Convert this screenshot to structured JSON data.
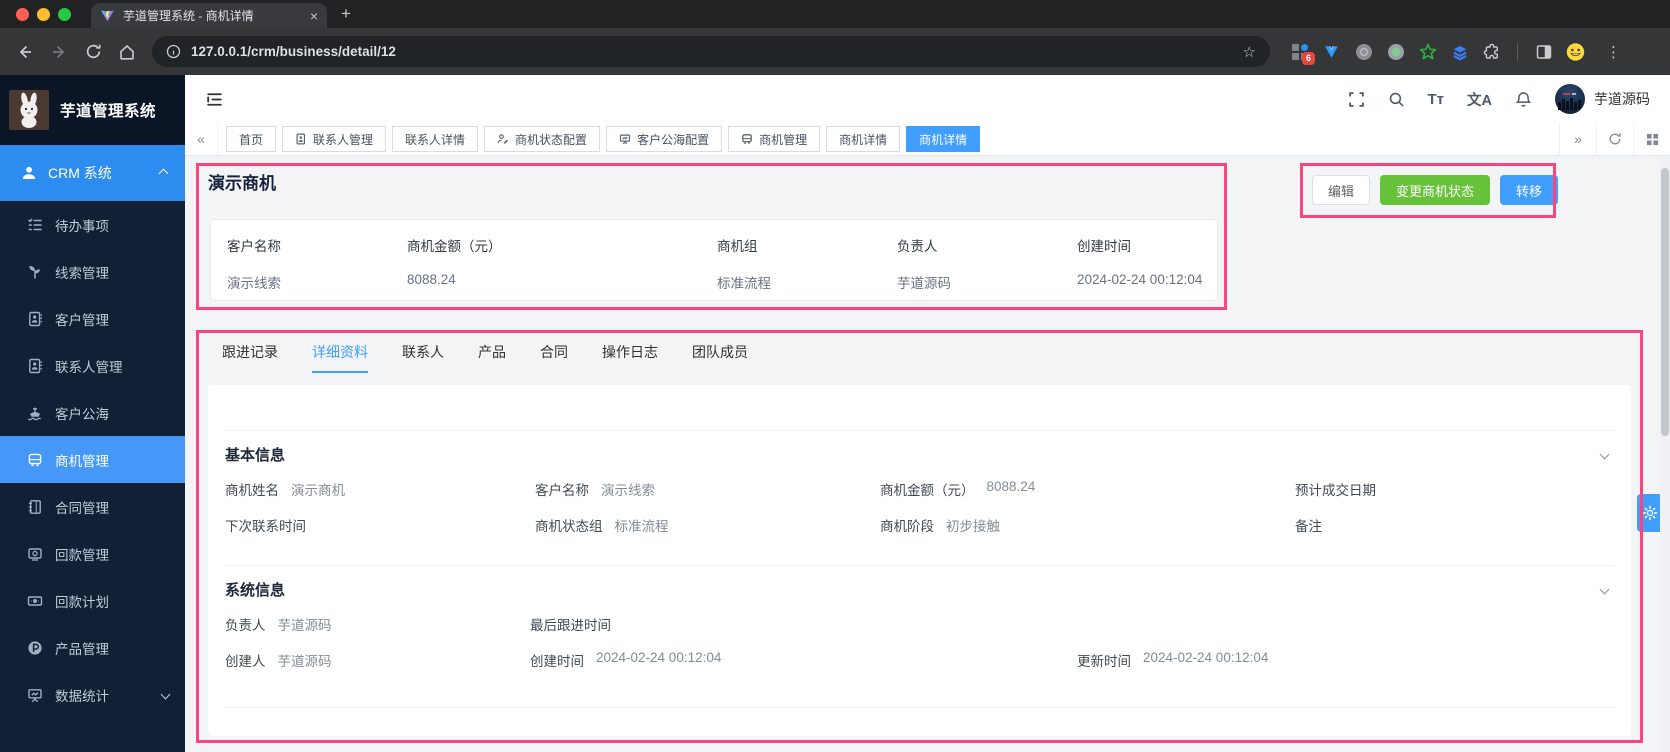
{
  "browser": {
    "tab_title": "芋道管理系统 - 商机详情",
    "url": "127.0.0.1/crm/business/detail/12",
    "extension_badge": "6"
  },
  "icons": {
    "close": "×",
    "new_tab": "+",
    "star": "☆",
    "kebab": "⋮",
    "collapse_left": "«",
    "collapse_right": "»",
    "font_size": "Tт",
    "locale": "文A"
  },
  "header": {
    "brand": "芋道管理系统",
    "username": "芋道源码"
  },
  "sidebar": {
    "section_label": "CRM 系统",
    "items": [
      {
        "label": "待办事项"
      },
      {
        "label": "线索管理"
      },
      {
        "label": "客户管理"
      },
      {
        "label": "联系人管理"
      },
      {
        "label": "客户公海"
      },
      {
        "label": "商机管理"
      },
      {
        "label": "合同管理"
      },
      {
        "label": "回款管理"
      },
      {
        "label": "回款计划"
      },
      {
        "label": "产品管理"
      },
      {
        "label": "数据统计"
      }
    ]
  },
  "tagbar": {
    "tabs": [
      {
        "label": "首页"
      },
      {
        "label": "联系人管理"
      },
      {
        "label": "联系人详情"
      },
      {
        "label": "商机状态配置"
      },
      {
        "label": "客户公海配置"
      },
      {
        "label": "商机管理"
      },
      {
        "label": "商机详情"
      },
      {
        "label": "商机详情"
      }
    ]
  },
  "opportunity": {
    "title": "演示商机",
    "actions": {
      "edit": "编辑",
      "change_status": "变更商机状态",
      "transfer": "转移"
    },
    "summary": [
      {
        "label": "客户名称",
        "value": "演示线索"
      },
      {
        "label": "商机金额（元）",
        "value": "8088.24"
      },
      {
        "label": "商机组",
        "value": "标准流程"
      },
      {
        "label": "负责人",
        "value": "芋道源码"
      },
      {
        "label": "创建时间",
        "value": "2024-02-24 00:12:04"
      }
    ]
  },
  "detail_tabs": [
    {
      "label": "跟进记录"
    },
    {
      "label": "详细资料"
    },
    {
      "label": "联系人"
    },
    {
      "label": "产品"
    },
    {
      "label": "合同"
    },
    {
      "label": "操作日志"
    },
    {
      "label": "团队成员"
    }
  ],
  "basic_info": {
    "title": "基本信息",
    "fields": [
      {
        "label": "商机姓名",
        "value": "演示商机"
      },
      {
        "label": "客户名称",
        "value": "演示线索"
      },
      {
        "label": "商机金额（元）",
        "value": "8088.24"
      },
      {
        "label": "预计成交日期",
        "value": ""
      },
      {
        "label": "下次联系时间",
        "value": ""
      },
      {
        "label": "商机状态组",
        "value": "标准流程"
      },
      {
        "label": "商机阶段",
        "value": "初步接触"
      },
      {
        "label": "备注",
        "value": ""
      }
    ]
  },
  "system_info": {
    "title": "系统信息",
    "fields": [
      {
        "label": "负责人",
        "value": "芋道源码"
      },
      {
        "label": "最后跟进时间",
        "value": ""
      },
      {
        "label": "创建人",
        "value": "芋道源码"
      },
      {
        "label": "创建时间",
        "value": "2024-02-24 00:12:04"
      },
      {
        "label": "更新时间",
        "value": "2024-02-24 00:12:04"
      }
    ]
  },
  "colors": {
    "accent": "#409eff",
    "success": "#67c23a",
    "annotation": "#f5477d",
    "sidebar_bg": "#122035"
  }
}
